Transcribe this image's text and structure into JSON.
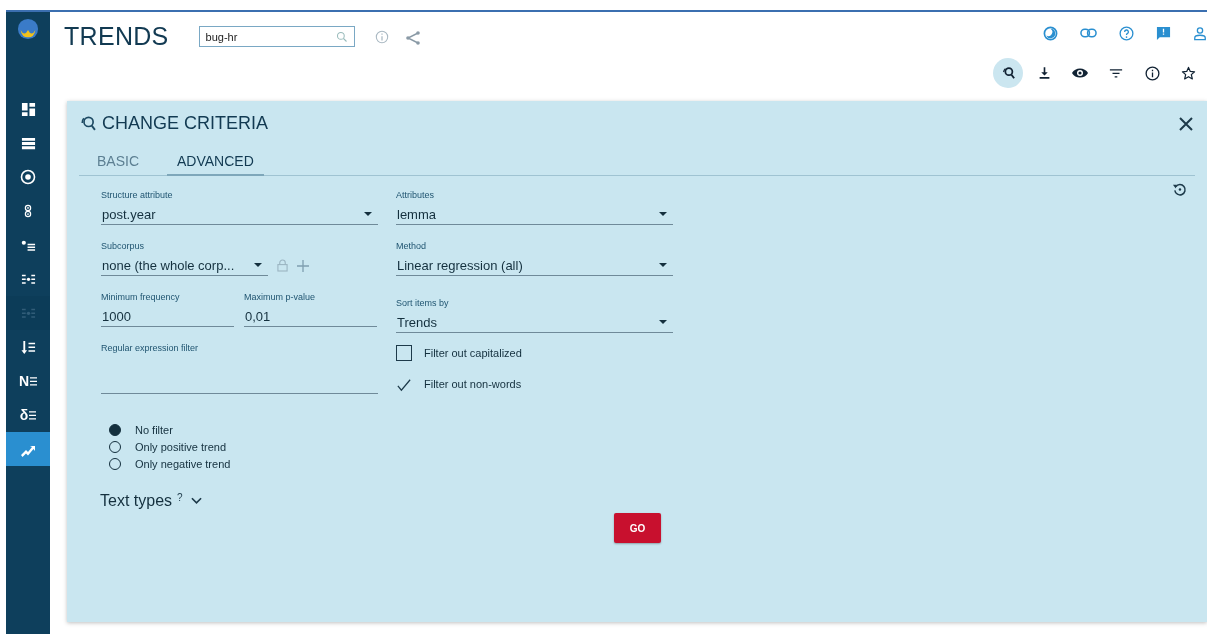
{
  "app": {
    "title": "TRENDS",
    "corpus_search": {
      "value": "bug-hr"
    }
  },
  "sidebar": {
    "items": [
      {
        "kind": "dashboard",
        "selected": false,
        "disabled": false
      },
      {
        "kind": "list",
        "selected": false,
        "disabled": false
      },
      {
        "kind": "target",
        "selected": false,
        "disabled": false
      },
      {
        "kind": "circles",
        "selected": false,
        "disabled": false
      },
      {
        "kind": "bullet-list",
        "selected": false,
        "disabled": false
      },
      {
        "kind": "dot-list",
        "selected": false,
        "disabled": false
      },
      {
        "kind": "dot-list",
        "selected": false,
        "disabled": true
      },
      {
        "kind": "sort-list",
        "selected": false,
        "disabled": false
      },
      {
        "kind": "letter-list",
        "glyph": "N",
        "selected": false,
        "disabled": false
      },
      {
        "kind": "letter-list",
        "glyph": "δ",
        "selected": false,
        "disabled": false
      },
      {
        "kind": "trend",
        "selected": true,
        "disabled": false
      }
    ]
  },
  "toolbar_top": [
    {
      "kind": "theme"
    },
    {
      "kind": "link"
    },
    {
      "kind": "help"
    },
    {
      "kind": "feedback"
    },
    {
      "kind": "user"
    }
  ],
  "toolbar_bottom": [
    {
      "kind": "search",
      "selected": true
    },
    {
      "kind": "download",
      "selected": false
    },
    {
      "kind": "eye",
      "selected": false
    },
    {
      "kind": "filter",
      "selected": false
    },
    {
      "kind": "info",
      "selected": false
    },
    {
      "kind": "star",
      "selected": false
    }
  ],
  "panel": {
    "title": "CHANGE CRITERIA",
    "tabs": [
      {
        "label": "BASIC",
        "selected": false
      },
      {
        "label": "ADVANCED",
        "selected": true
      }
    ],
    "structure_attribute": {
      "label": "Structure attribute",
      "value": "post.year"
    },
    "attributes": {
      "label": "Attributes",
      "value": "lemma"
    },
    "subcorpus": {
      "label": "Subcorpus",
      "value": "none (the whole corp..."
    },
    "method": {
      "label": "Method",
      "value": "Linear regression (all)"
    },
    "minimum_frequency": {
      "label": "Minimum frequency",
      "value": "1000"
    },
    "maximum_p_value": {
      "label": "Maximum p-value",
      "value": "0,01"
    },
    "sort_items_by": {
      "label": "Sort items by",
      "value": "Trends"
    },
    "regex_filter": {
      "label": "Regular expression filter"
    },
    "checkboxes": [
      {
        "label": "Filter out capitalized",
        "checked": false
      },
      {
        "label": "Filter out non-words",
        "checked": true
      }
    ],
    "trend_filter": [
      {
        "label": "No filter",
        "selected": true
      },
      {
        "label": "Only positive trend",
        "selected": false
      },
      {
        "label": "Only negative trend",
        "selected": false
      }
    ],
    "text_types": {
      "label": "Text types",
      "hint": "?",
      "expanded": false
    },
    "submit": "GO"
  }
}
